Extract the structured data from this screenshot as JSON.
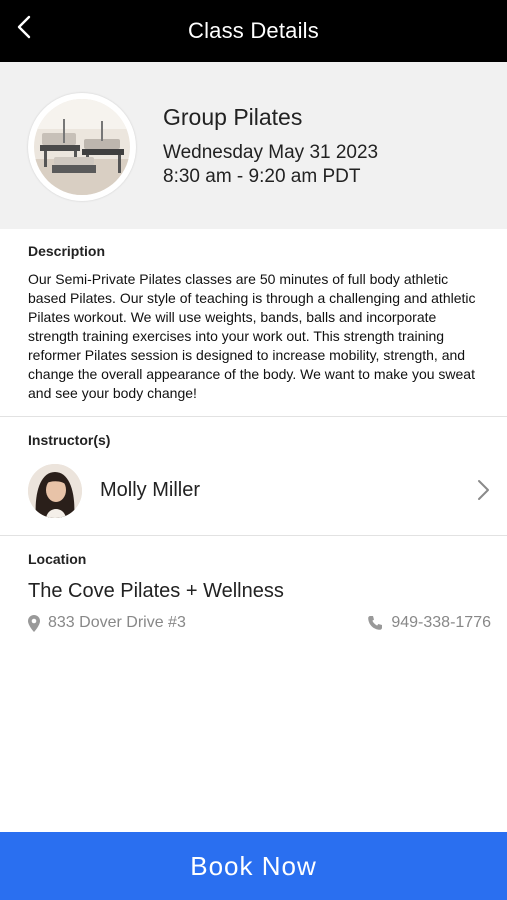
{
  "header": {
    "title": "Class Details"
  },
  "class_info": {
    "name": "Group Pilates",
    "date": "Wednesday May 31 2023",
    "time": "8:30 am - 9:20 am PDT"
  },
  "description": {
    "label": "Description",
    "text": "Our Semi-Private Pilates classes are 50 minutes of full body athletic based Pilates. Our style of teaching is through a challenging and athletic Pilates workout. We will use weights, bands, balls and incorporate strength training exercises into your work out. This strength training reformer Pilates session is designed to increase mobility, strength, and change the overall appearance of the body. We want to make you sweat and see your body change!"
  },
  "instructors": {
    "label": "Instructor(s)",
    "items": [
      {
        "name": "Molly Miller"
      }
    ]
  },
  "location": {
    "label": "Location",
    "name": "The Cove Pilates + Wellness",
    "address": "833 Dover Drive #3",
    "phone": "949-338-1776"
  },
  "actions": {
    "book_label": "Book Now"
  },
  "colors": {
    "topbar": "#000000",
    "header_bg": "#f1f1f1",
    "accent": "#2a6ff0",
    "muted_text": "#888888"
  },
  "icons": {
    "back": "chevron-left-icon",
    "chevron": "chevron-right-icon",
    "address": "map-pin-icon",
    "phone": "phone-icon"
  }
}
